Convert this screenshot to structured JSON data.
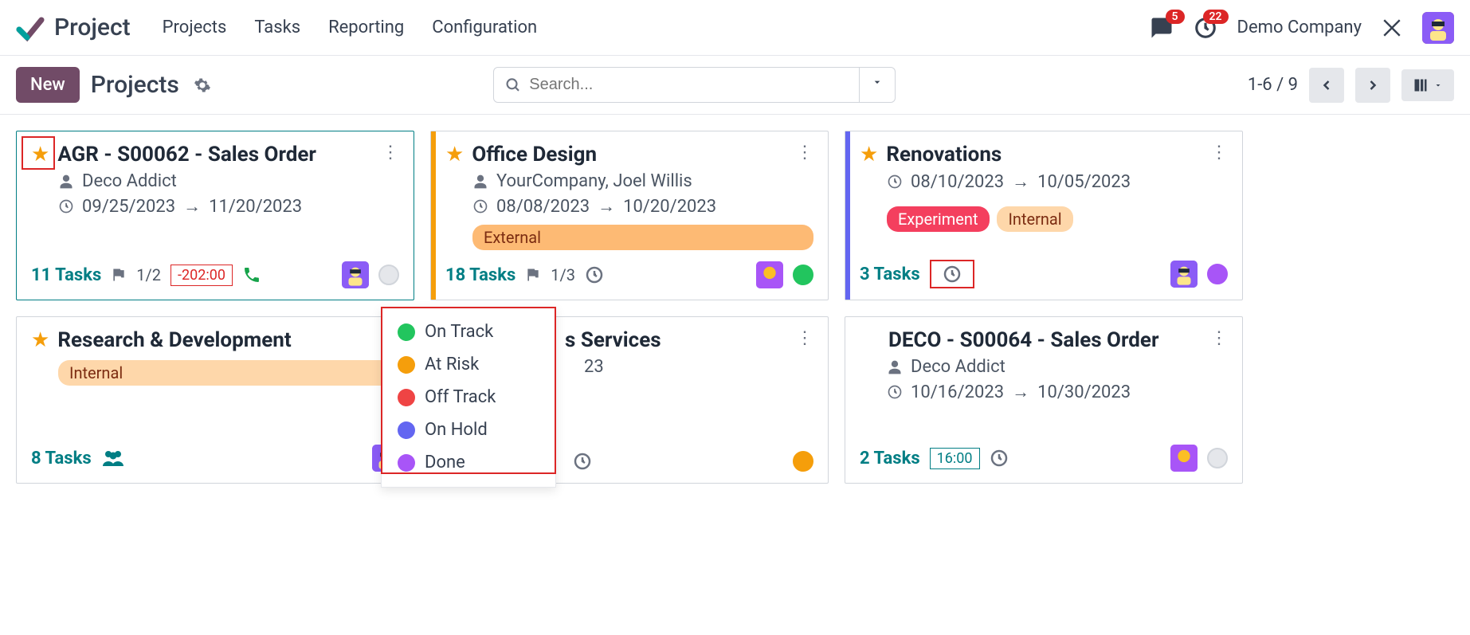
{
  "app": {
    "title": "Project"
  },
  "nav": {
    "projects": "Projects",
    "tasks": "Tasks",
    "reporting": "Reporting",
    "configuration": "Configuration"
  },
  "header": {
    "messages_badge": "5",
    "activities_badge": "22",
    "company": "Demo Company"
  },
  "toolbar": {
    "new_label": "New",
    "breadcrumb": "Projects",
    "search_placeholder": "Search...",
    "pager": "1-6 / 9"
  },
  "status_popover": {
    "on_track": "On Track",
    "at_risk": "At Risk",
    "off_track": "Off Track",
    "on_hold": "On Hold",
    "done": "Done"
  },
  "cards": {
    "c0": {
      "title": "AGR - S00062 - Sales Order",
      "customer": "Deco Addict",
      "date_start": "09/25/2023",
      "date_end": "11/20/2023",
      "tasks": "11 Tasks",
      "milestone": "1/2",
      "time": "-202:00"
    },
    "c1": {
      "title": "Office Design",
      "customer": "YourCompany, Joel Willis",
      "date_start": "08/08/2023",
      "date_end": "10/20/2023",
      "tag": "External",
      "tasks": "18 Tasks",
      "milestone": "1/3"
    },
    "c2": {
      "title": "Renovations",
      "date_start": "08/10/2023",
      "date_end": "10/05/2023",
      "tag1": "Experiment",
      "tag2": "Internal",
      "tasks": "3 Tasks"
    },
    "c3": {
      "title": "Research & Development",
      "tag": "Internal",
      "tasks": "8 Tasks"
    },
    "c4": {
      "title_partial": "s Services",
      "date_partial": "23",
      "tasks": ""
    },
    "c5": {
      "title": "DECO - S00064 - Sales Order",
      "customer": "Deco Addict",
      "date_start": "10/16/2023",
      "date_end": "10/30/2023",
      "tasks": "2 Tasks",
      "time": "16:00"
    }
  }
}
